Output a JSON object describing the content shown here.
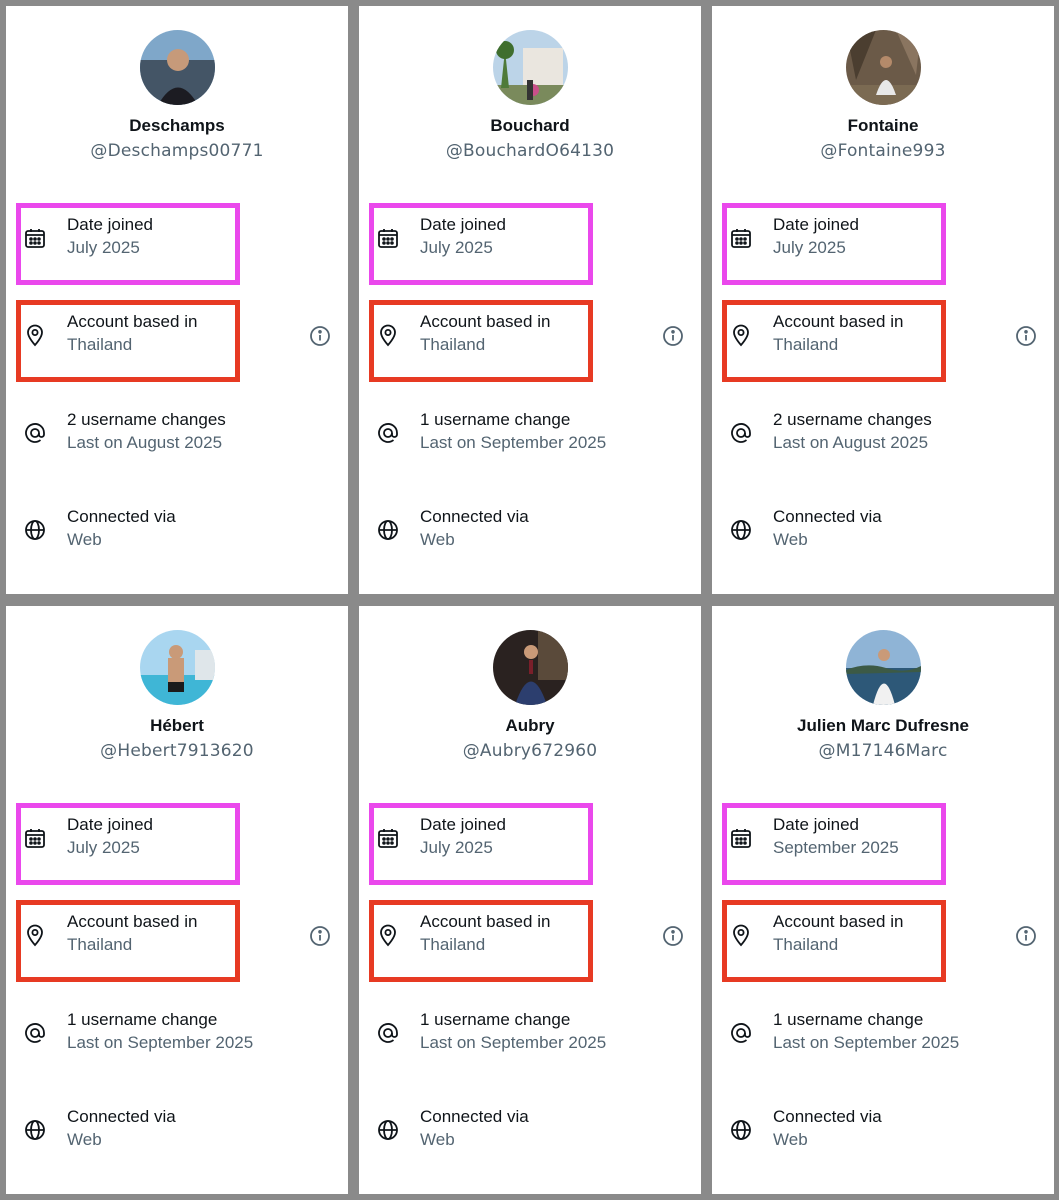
{
  "accounts": [
    {
      "name": "Deschamps",
      "handle": "@Deschamps00771",
      "date_joined": {
        "label": "Date joined",
        "value": "July 2025"
      },
      "based_in": {
        "label": "Account based in",
        "value": "Thailand"
      },
      "username_changes": {
        "label": "2 username changes",
        "value": "Last on August 2025"
      },
      "connected": {
        "label": "Connected via",
        "value": "Web"
      }
    },
    {
      "name": "Bouchard",
      "handle": "@BouchardO64130",
      "date_joined": {
        "label": "Date joined",
        "value": "July 2025"
      },
      "based_in": {
        "label": "Account based in",
        "value": "Thailand"
      },
      "username_changes": {
        "label": "1 username change",
        "value": "Last on September 2025"
      },
      "connected": {
        "label": "Connected via",
        "value": "Web"
      }
    },
    {
      "name": "Fontaine",
      "handle": "@Fontaine993",
      "date_joined": {
        "label": "Date joined",
        "value": "July 2025"
      },
      "based_in": {
        "label": "Account based in",
        "value": "Thailand"
      },
      "username_changes": {
        "label": "2 username changes",
        "value": "Last on August 2025"
      },
      "connected": {
        "label": "Connected via",
        "value": "Web"
      }
    },
    {
      "name": "Hébert",
      "handle": "@Hebert7913620",
      "date_joined": {
        "label": "Date joined",
        "value": "July 2025"
      },
      "based_in": {
        "label": "Account based in",
        "value": "Thailand"
      },
      "username_changes": {
        "label": "1 username change",
        "value": "Last on September 2025"
      },
      "connected": {
        "label": "Connected via",
        "value": "Web"
      }
    },
    {
      "name": "Aubry",
      "handle": "@Aubry672960",
      "date_joined": {
        "label": "Date joined",
        "value": "July 2025"
      },
      "based_in": {
        "label": "Account based in",
        "value": "Thailand"
      },
      "username_changes": {
        "label": "1 username change",
        "value": "Last on September 2025"
      },
      "connected": {
        "label": "Connected via",
        "value": "Web"
      }
    },
    {
      "name": "Julien Marc Dufresne",
      "handle": "@M17146Marc",
      "date_joined": {
        "label": "Date joined",
        "value": "September 2025"
      },
      "based_in": {
        "label": "Account based in",
        "value": "Thailand"
      },
      "username_changes": {
        "label": "1 username change",
        "value": "Last on September 2025"
      },
      "connected": {
        "label": "Connected via",
        "value": "Web"
      }
    }
  ],
  "colors": {
    "highlight_date_joined": "#ea48ec",
    "highlight_based_in": "#e73a23",
    "background": "#8a8a8a",
    "card": "#ffffff",
    "primary_text": "#0f1419",
    "secondary_text": "#536471"
  },
  "icons": {
    "date_joined": "calendar-icon",
    "based_in": "location-pin-icon",
    "username_changes": "at-sign-icon",
    "connected": "globe-icon",
    "info": "info-icon"
  }
}
